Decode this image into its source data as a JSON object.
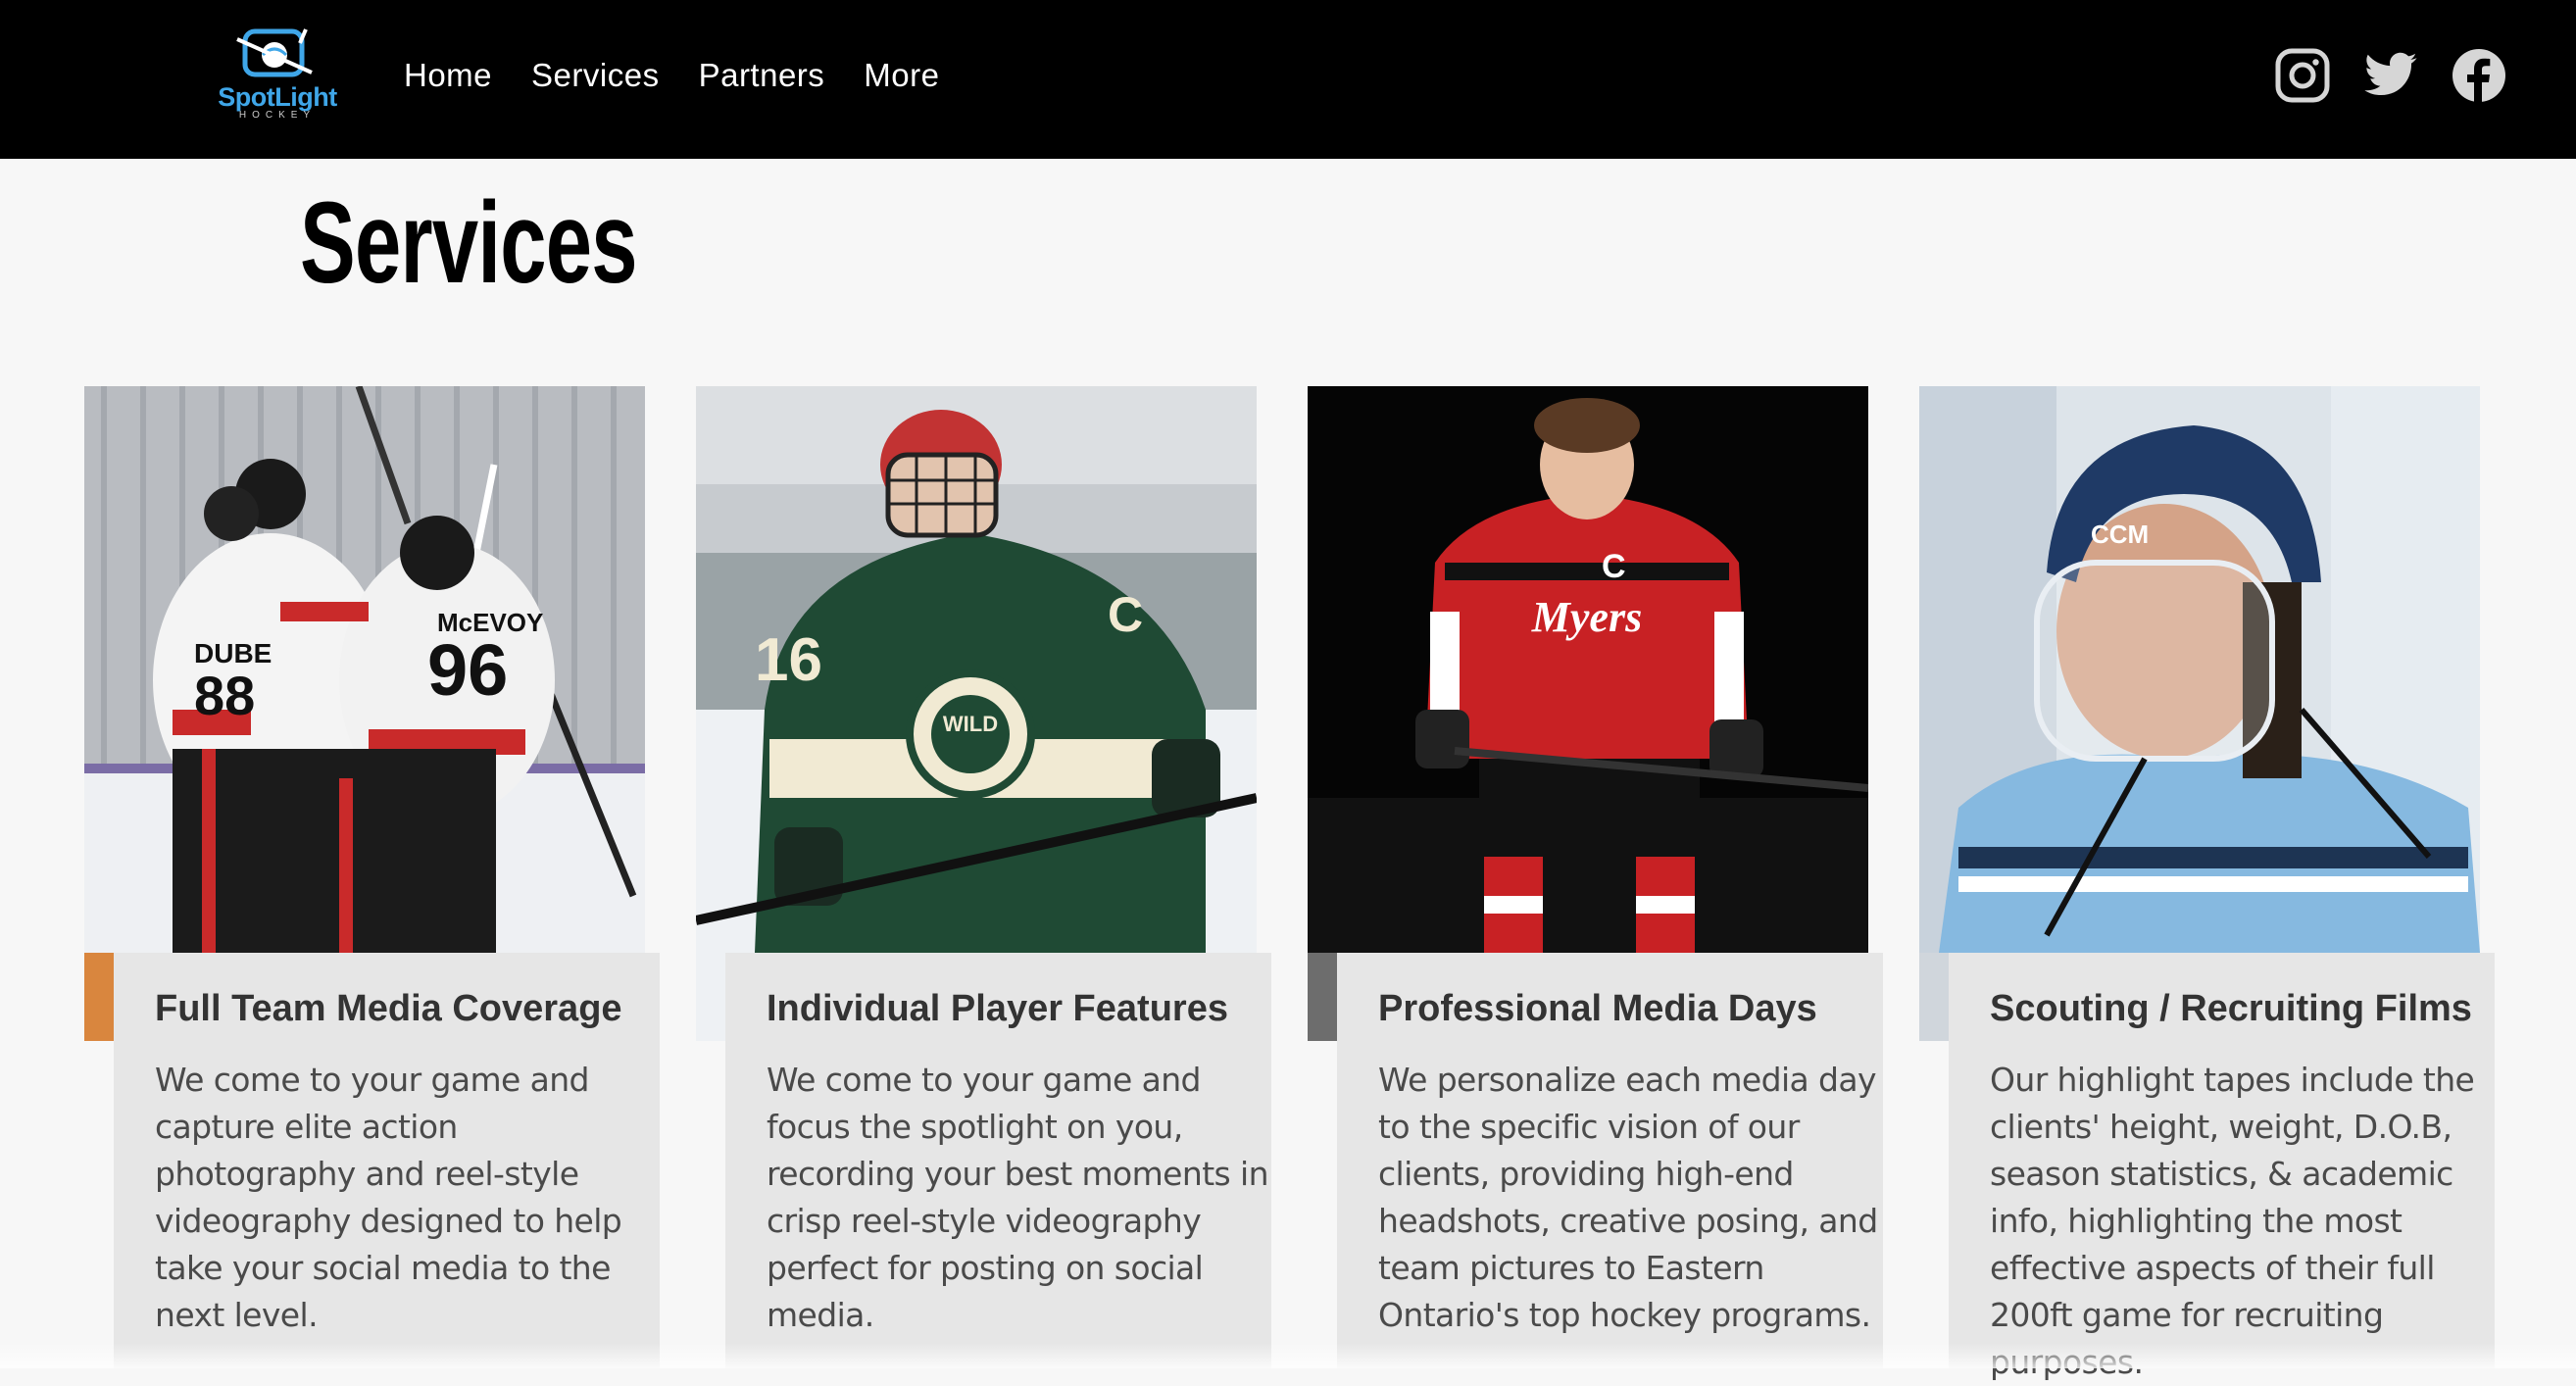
{
  "brand": {
    "logo_text": "SpotLight",
    "logo_subtext": "HOCKEY",
    "accent": "#3fa6e8"
  },
  "nav": {
    "items": [
      {
        "label": "Home"
      },
      {
        "label": "Services"
      },
      {
        "label": "Partners"
      },
      {
        "label": "More"
      }
    ]
  },
  "social": [
    {
      "icon": "instagram-icon"
    },
    {
      "icon": "twitter-icon"
    },
    {
      "icon": "facebook-icon"
    }
  ],
  "page": {
    "title": "Services"
  },
  "cards": [
    {
      "title": "Full Team Media Coverage",
      "text": "We come to your game and capture elite action photography and reel-style videography designed to help take your social media to the next level.",
      "jersey_names": [
        "DUBE",
        "McEVOY"
      ],
      "jersey_numbers": [
        "88",
        "96"
      ]
    },
    {
      "title": "Individual Player Features",
      "text": "We come to your game and focus the spotlight on you, recording your best moments in crisp reel-style videography perfect for posting on social media.",
      "jersey_number": "16",
      "captain": "C",
      "crest": "WILD"
    },
    {
      "title": "Professional Media Days",
      "text": "We personalize each media day to the specific vision of our clients, providing high-end headshots, creative posing, and team pictures to Eastern Ontario's top hockey programs.",
      "jersey_text": "Myers",
      "captain": "C"
    },
    {
      "title": "Scouting / Recruiting Films",
      "text": "Our highlight tapes include the clients' height, weight, D.O.B, season statistics, & academic info, highlighting the most effective aspects of their full 200ft game for recruiting purposes.",
      "helmet_brand": "CCM"
    }
  ],
  "colors": {
    "topbar": "#000000",
    "background": "#f7f7f7",
    "card_box": "#e6e6e6",
    "icon_gray": "#d6d6d6"
  }
}
